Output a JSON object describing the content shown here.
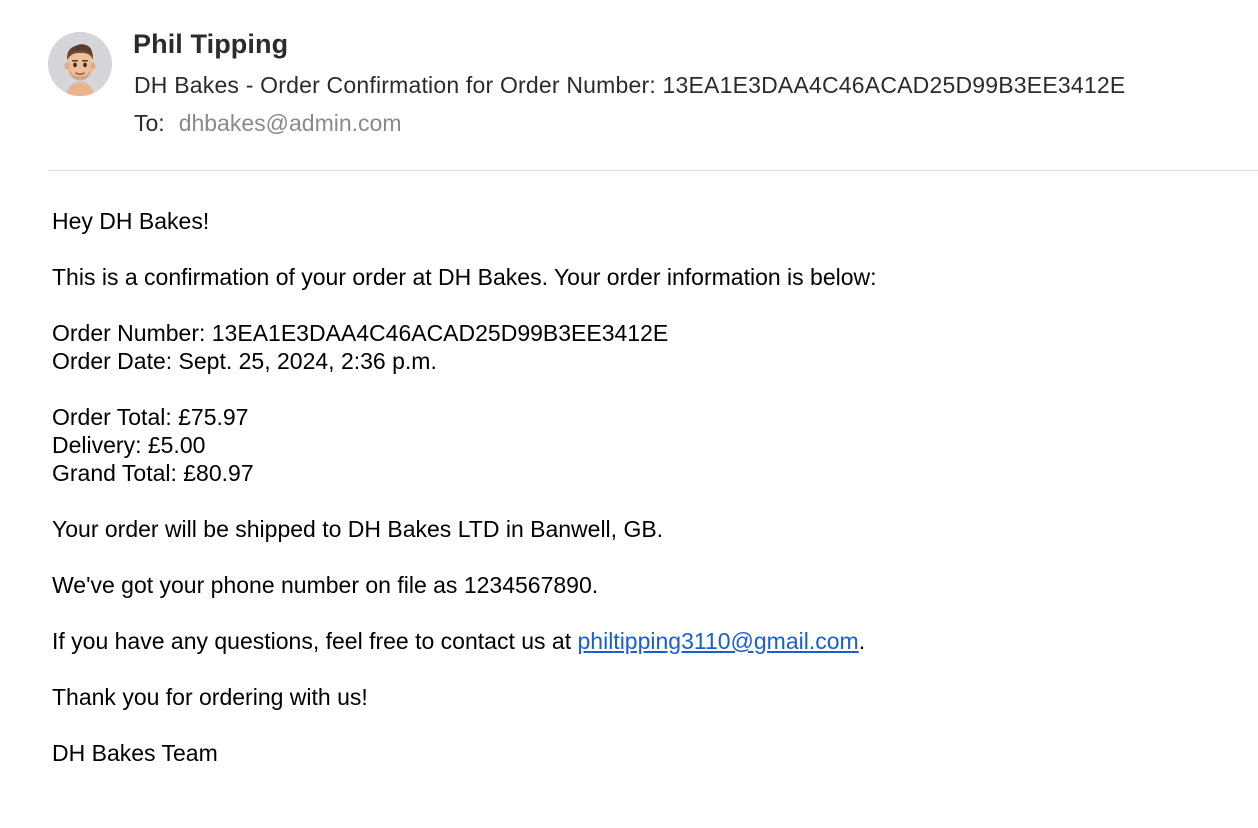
{
  "email": {
    "sender_name": "Phil Tipping",
    "subject": "DH Bakes - Order Confirmation for Order Number: 13EA1E3DAA4C46ACAD25D99B3EE3412E",
    "to_label": "To:",
    "to_address": "dhbakes@admin.com",
    "avatar_icon": "memoji-avatar-icon"
  },
  "message": {
    "greeting": "Hey DH Bakes!",
    "intro": "This is a confirmation of your order at DH Bakes. Your order information is below:",
    "order_number": "Order Number: 13EA1E3DAA4C46ACAD25D99B3EE3412E",
    "order_date": "Order Date: Sept. 25, 2024, 2:36 p.m.",
    "order_total": "Order Total: £75.97",
    "delivery": "Delivery: £5.00",
    "grand_total": "Grand Total: £80.97",
    "shipping": "Your order will be shipped to DH Bakes LTD in Banwell, GB.",
    "phone": "We've got your phone number on file as 1234567890.",
    "contact_prefix": "If you have any questions, feel free to contact us at ",
    "contact_email": "philtipping3110@gmail.com",
    "contact_suffix": ".",
    "thanks": "Thank you for ordering with us!",
    "signoff": "DH Bakes Team"
  },
  "colors": {
    "link": "#1a5fd0",
    "to_address": "#8a8a8e",
    "divider": "#d9d9dc"
  }
}
